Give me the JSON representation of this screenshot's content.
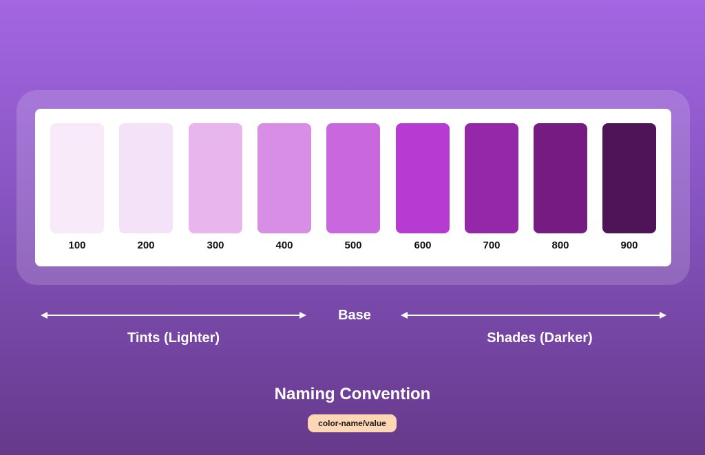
{
  "swatches": [
    {
      "label": "100",
      "color": "#f8eaf9"
    },
    {
      "label": "200",
      "color": "#f3e2f8"
    },
    {
      "label": "300",
      "color": "#e8b5ec"
    },
    {
      "label": "400",
      "color": "#d88ee4"
    },
    {
      "label": "500",
      "color": "#c867de"
    },
    {
      "label": "600",
      "color": "#b53bd3"
    },
    {
      "label": "700",
      "color": "#9527a9"
    },
    {
      "label": "800",
      "color": "#761b82"
    },
    {
      "label": "900",
      "color": "#4e1457"
    }
  ],
  "scale": {
    "base_label": "Base",
    "tints_label": "Tints (Lighter)",
    "shades_label": "Shades (Darker)"
  },
  "naming": {
    "title": "Naming Convention",
    "pattern": "color-name/value"
  }
}
